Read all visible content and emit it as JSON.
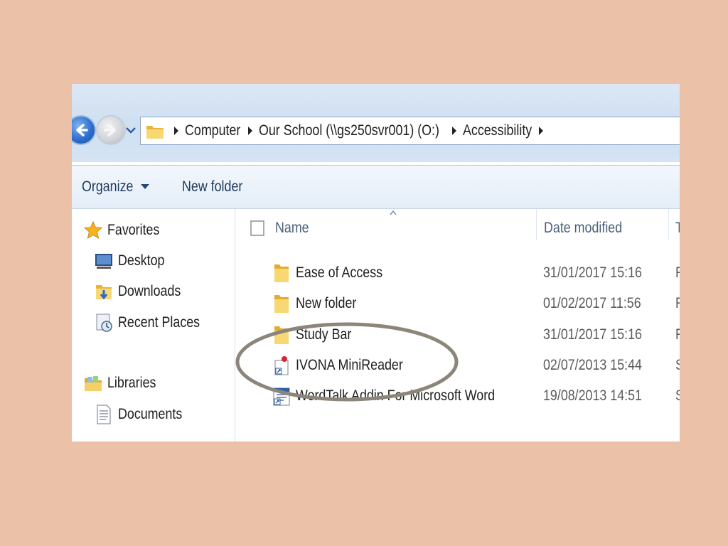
{
  "address": {
    "crumbs": [
      "Computer",
      "Our School (\\\\gs250svr001) (O:)",
      "Accessibility"
    ]
  },
  "toolbar": {
    "organize_label": "Organize",
    "new_folder_label": "New folder"
  },
  "nav": {
    "favorites_label": "Favorites",
    "desktop_label": "Desktop",
    "downloads_label": "Downloads",
    "recent_label": "Recent Places",
    "libraries_label": "Libraries",
    "documents_label": "Documents"
  },
  "columns": {
    "name": "Name",
    "date": "Date modified",
    "type": "T"
  },
  "files": [
    {
      "name": "Ease of Access",
      "date": "31/01/2017 15:16",
      "type": "F",
      "icon": "folder-icon"
    },
    {
      "name": "New folder",
      "date": "01/02/2017 11:56",
      "type": "F",
      "icon": "folder-icon"
    },
    {
      "name": "Study Bar",
      "date": "31/01/2017 15:16",
      "type": "F",
      "icon": "folder-icon"
    },
    {
      "name": "IVONA MiniReader",
      "date": "02/07/2013 15:44",
      "type": "S",
      "icon": "shortcut-icon"
    },
    {
      "name": "WordTalk Addin For Microsoft Word",
      "date": "19/08/2013 14:51",
      "type": "S",
      "icon": "word-shortcut-icon"
    }
  ],
  "colors": {
    "background": "#EBC2A8",
    "annotation_ellipse": "#8c857a",
    "folder_yellow": "#f3cf5a"
  }
}
